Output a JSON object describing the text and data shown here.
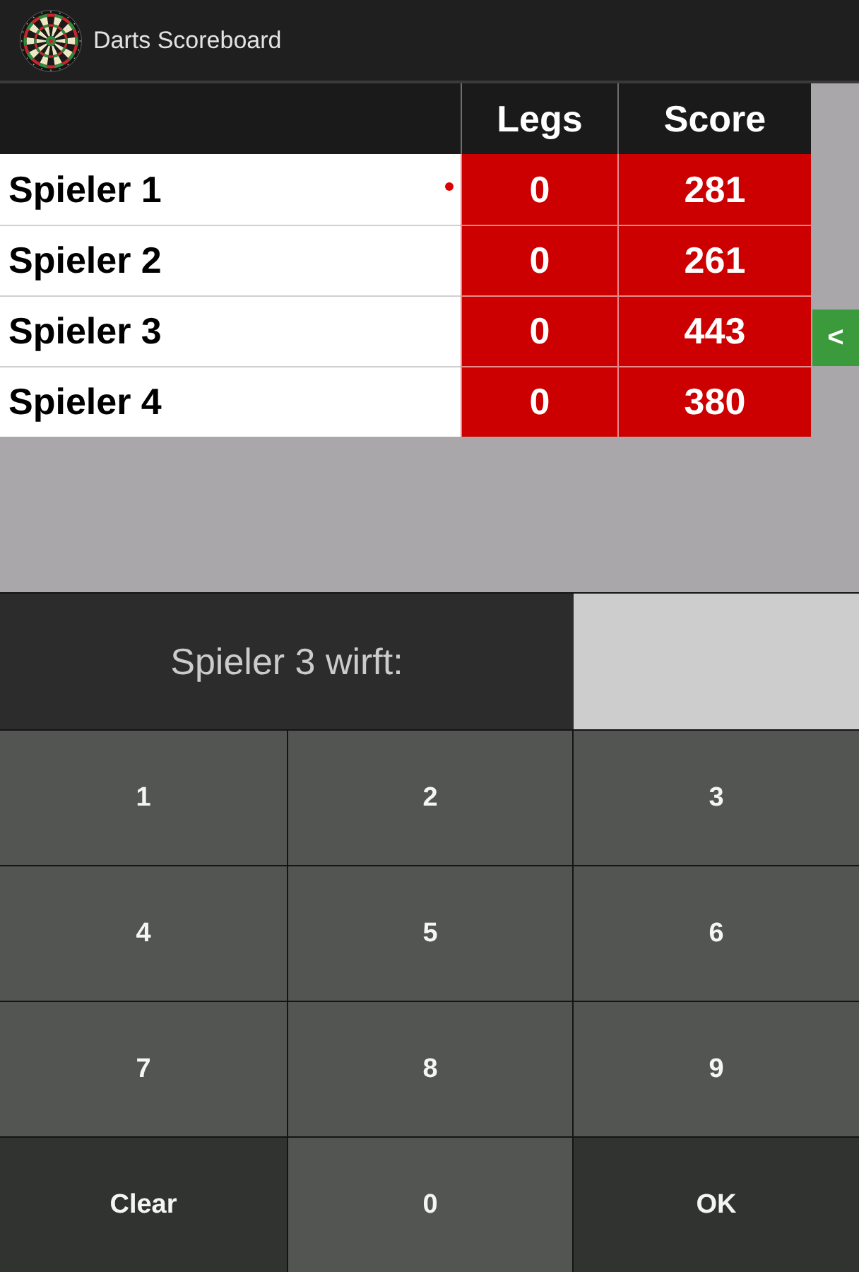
{
  "app_bar": {
    "title": "Darts Scoreboard"
  },
  "scoreboard": {
    "columns": [
      "Legs",
      "Score"
    ],
    "turn_marker": "<",
    "players": [
      {
        "name": "Spieler 1",
        "legs": "0",
        "score": "281",
        "starter": true,
        "throwing": false
      },
      {
        "name": "Spieler 2",
        "legs": "0",
        "score": "261",
        "starter": false,
        "throwing": false
      },
      {
        "name": "Spieler 3",
        "legs": "0",
        "score": "443",
        "starter": false,
        "throwing": true
      },
      {
        "name": "Spieler 4",
        "legs": "0",
        "score": "380",
        "starter": false,
        "throwing": false
      }
    ]
  },
  "input_panel": {
    "prompt": "Spieler 3 wirft:"
  },
  "keypad": [
    {
      "label": "1",
      "kind": "digit"
    },
    {
      "label": "2",
      "kind": "digit"
    },
    {
      "label": "3",
      "kind": "digit"
    },
    {
      "label": "4",
      "kind": "digit"
    },
    {
      "label": "5",
      "kind": "digit"
    },
    {
      "label": "6",
      "kind": "digit"
    },
    {
      "label": "7",
      "kind": "digit"
    },
    {
      "label": "8",
      "kind": "digit"
    },
    {
      "label": "9",
      "kind": "digit"
    },
    {
      "label": "Clear",
      "kind": "clear"
    },
    {
      "label": "0",
      "kind": "digit"
    },
    {
      "label": "OK",
      "kind": "confirm"
    }
  ]
}
